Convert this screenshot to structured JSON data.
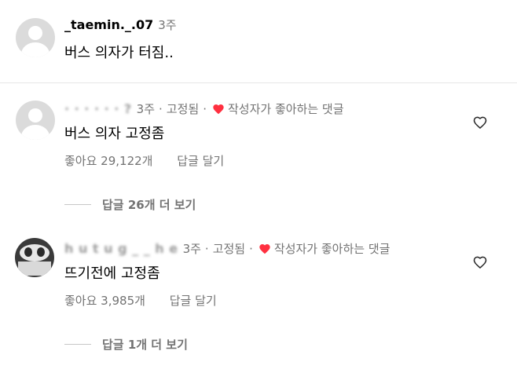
{
  "comments": [
    {
      "username": "_taemin._.07",
      "time": "3주",
      "text": "버스 의자가 터짐.."
    },
    {
      "username": "·  ·  ·  ·  ·  ·  ?",
      "time": "3주",
      "pinned": "고정됨",
      "author_liked": "작성자가 좋아하는 댓글",
      "text": "버스 의자 고정좀",
      "likes": "좋아요 29,122개",
      "reply": "답글 달기",
      "view_replies": "답글 26개 더 보기"
    },
    {
      "username": "h u t u g _ _ h e",
      "time": "3주",
      "pinned": "고정됨",
      "author_liked": "작성자가 좋아하는 댓글",
      "text": "뜨기전에 고정좀",
      "likes": "좋아요 3,985개",
      "reply": "답글 달기",
      "view_replies": "답글 1개 더 보기"
    }
  ],
  "separator": "·",
  "colors": {
    "heart": "#ff3040",
    "muted_text": "#737373",
    "avatar_placeholder": "#dbdbdb"
  },
  "icons": {
    "like": "heart-outline-icon",
    "author_liked": "heart-filled-icon",
    "avatar": "default-avatar-icon"
  }
}
